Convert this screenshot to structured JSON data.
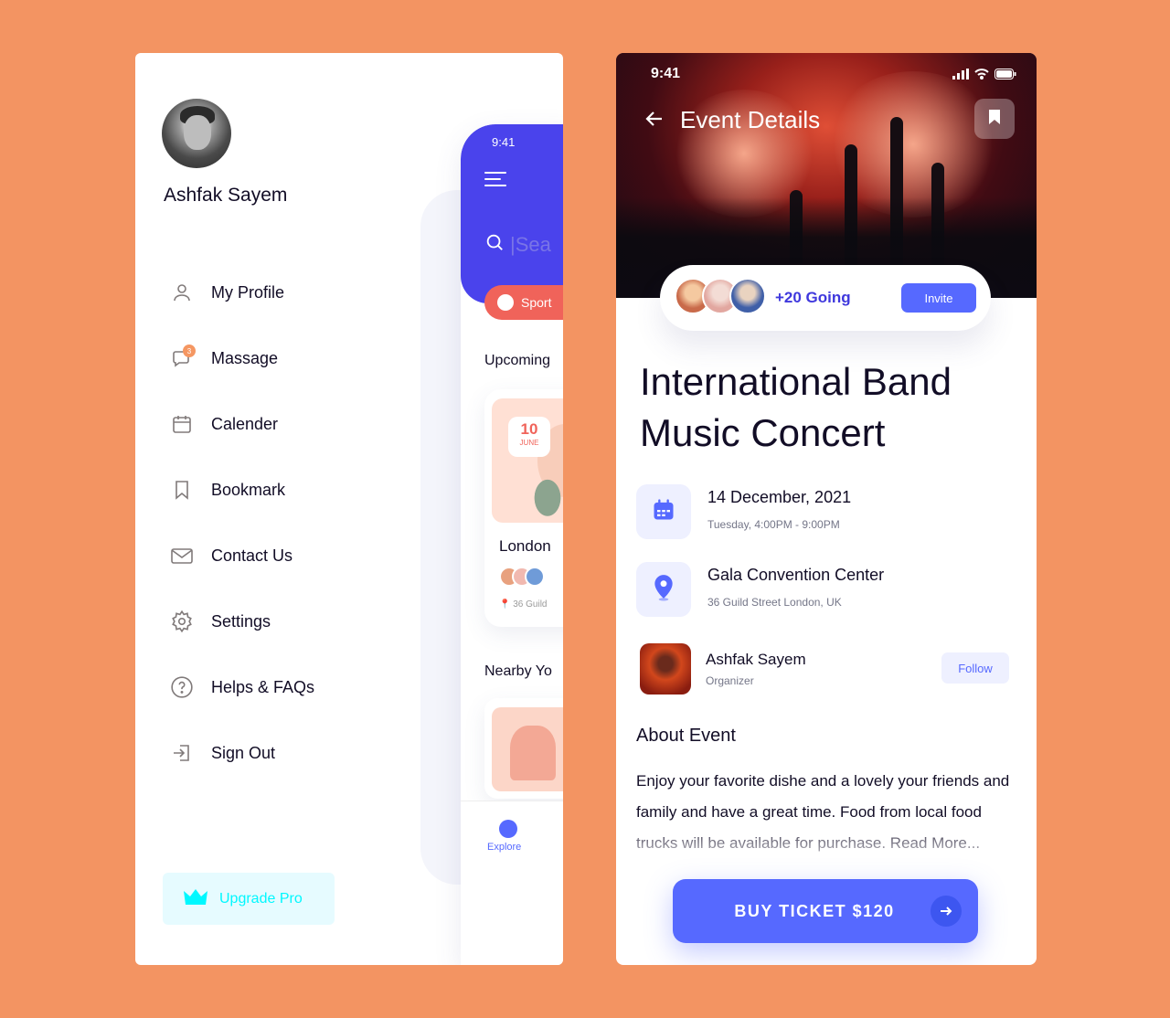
{
  "drawer": {
    "user_name": "Ashfak Sayem",
    "menu": [
      {
        "label": "My Profile",
        "icon": "user-icon"
      },
      {
        "label": "Massage",
        "icon": "message-icon",
        "badge": "3"
      },
      {
        "label": "Calender",
        "icon": "calendar-icon"
      },
      {
        "label": "Bookmark",
        "icon": "bookmark-icon"
      },
      {
        "label": "Contact Us",
        "icon": "mail-icon"
      },
      {
        "label": "Settings",
        "icon": "gear-icon"
      },
      {
        "label": "Helps & FAQs",
        "icon": "help-icon"
      },
      {
        "label": "Sign Out",
        "icon": "sign-out-icon"
      }
    ],
    "upgrade_label": "Upgrade Pro"
  },
  "mini_phone": {
    "time": "9:41",
    "search_placeholder": "|Sea",
    "chip_label": "Sport",
    "upcoming_heading": "Upcoming",
    "event_day": "10",
    "event_month": "JUNE",
    "event_title": "London",
    "event_location": "36 Guild",
    "nearby_heading": "Nearby Yo",
    "nav_label": "Explore"
  },
  "event": {
    "status_time": "9:41",
    "page_title": "Event Details",
    "going_text": "+20 Going",
    "invite_label": "Invite",
    "title": "International Band Music Concert",
    "date_main": "14 December, 2021",
    "date_sub": "Tuesday, 4:00PM - 9:00PM",
    "venue_main": "Gala Convention Center",
    "venue_sub": "36 Guild Street London, UK",
    "organizer_name": "Ashfak Sayem",
    "organizer_role": "Organizer",
    "follow_label": "Follow",
    "about_heading": "About Event",
    "about_text": "Enjoy your favorite dishe and a lovely your friends and family and have a great time. Food from local food trucks will be available for purchase. Read More...",
    "buy_label": "BUY TICKET $120"
  },
  "colors": {
    "background": "#F39462",
    "primary": "#5669FF",
    "header_blue": "#4A43EC",
    "chip_red": "#F0635A",
    "upgrade_text": "#00F8FF",
    "text_dark": "#120D26"
  }
}
